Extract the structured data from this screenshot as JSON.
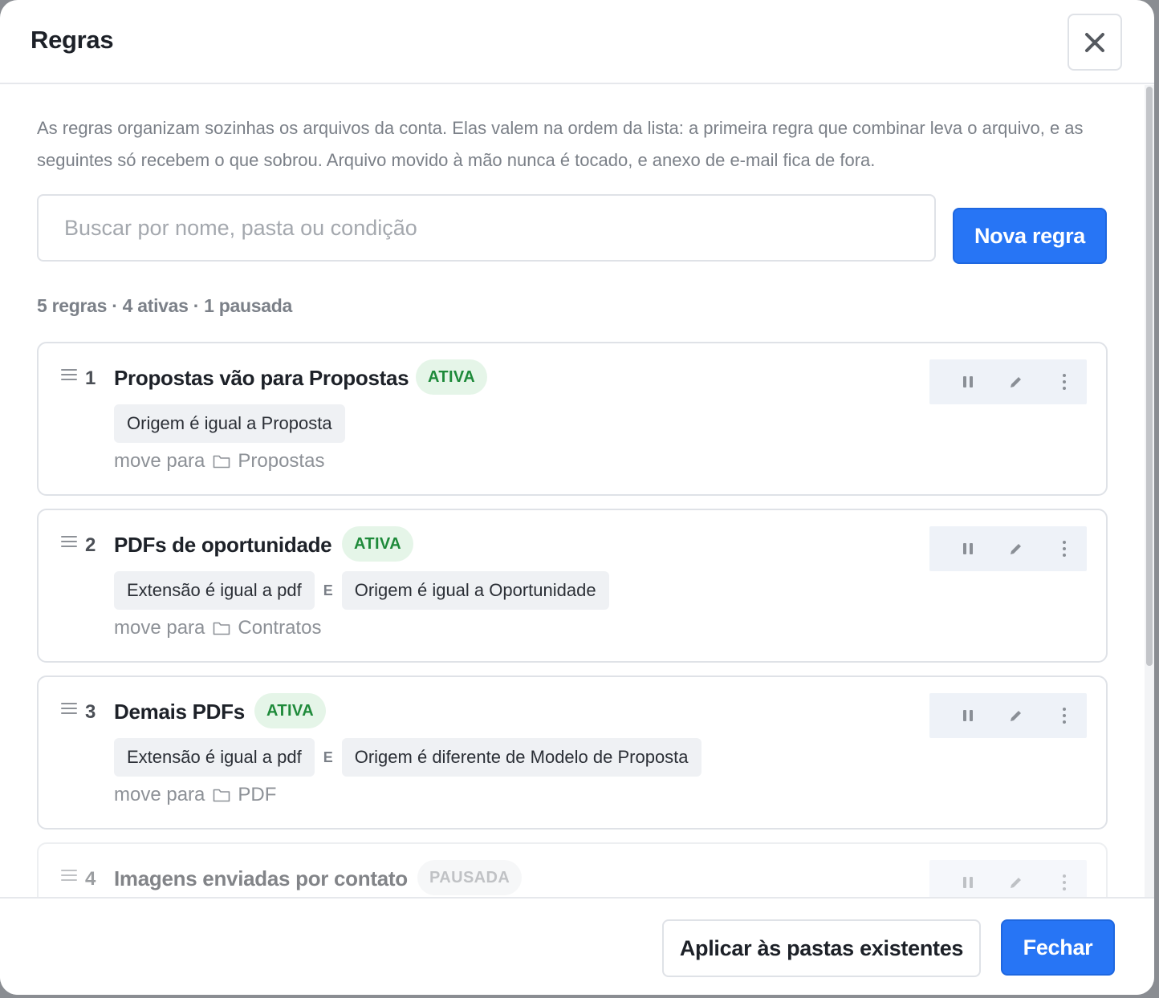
{
  "modal": {
    "title": "Regras",
    "close_icon": "close-icon",
    "description": "As regras organizam sozinhas os arquivos da conta. Elas valem na ordem da lista: a primeira regra que combinar leva o arquivo, e as seguintes só recebem o que sobrou. Arquivo movido à mão nunca é tocado, e anexo de e-mail fica de fora.",
    "search": {
      "placeholder": "Buscar por nome, pasta ou condição",
      "value": ""
    },
    "new_rule_label": "Nova regra",
    "summary": "5 regras · 4 ativas · 1 pausada",
    "move_label": "move para",
    "join_label": "E",
    "rules": [
      {
        "number": "1",
        "name": "Propostas vão para Propostas",
        "status": "ATIVA",
        "conditions": [
          "Origem é igual a Proposta"
        ],
        "folder": "Propostas"
      },
      {
        "number": "2",
        "name": "PDFs de oportunidade",
        "status": "ATIVA",
        "conditions": [
          "Extensão é igual a pdf",
          "Origem é igual a Oportunidade"
        ],
        "folder": "Contratos"
      },
      {
        "number": "3",
        "name": "Demais PDFs",
        "status": "ATIVA",
        "conditions": [
          "Extensão é igual a pdf",
          "Origem é diferente de Modelo de Proposta"
        ],
        "folder": "PDF"
      },
      {
        "number": "4",
        "name": "Imagens enviadas por contato",
        "status": "PAUSADA",
        "conditions": [],
        "folder": ""
      }
    ],
    "footer": {
      "apply_label": "Aplicar às pastas existentes",
      "close_label": "Fechar"
    }
  },
  "colors": {
    "primary": "#2775f5",
    "active_badge_bg": "#e5f5e8",
    "active_badge_text": "#1e8a3a",
    "paused_badge_bg": "#f0f1f3",
    "muted_text": "#7b8088"
  },
  "icons": [
    "close-icon",
    "drag-handle-icon",
    "pause-icon",
    "edit-icon",
    "more-icon",
    "folder-icon"
  ]
}
